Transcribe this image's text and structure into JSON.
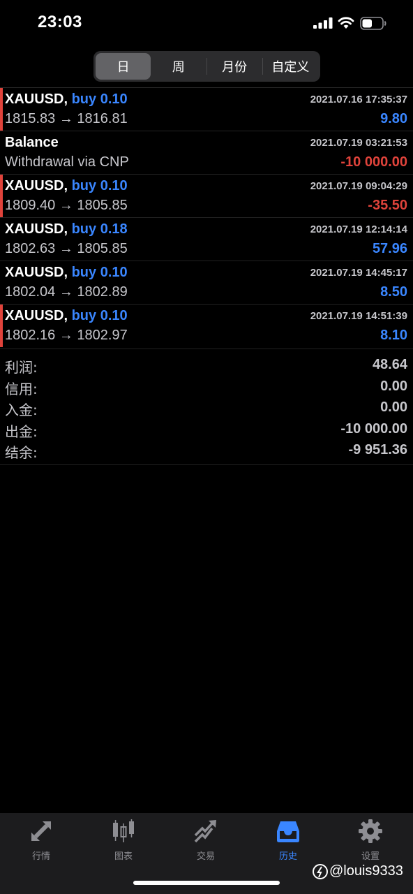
{
  "status": {
    "time": "23:03",
    "battery_level": 0.5
  },
  "segments": [
    {
      "label": "日",
      "active": true
    },
    {
      "label": "周",
      "active": false
    },
    {
      "label": "月份",
      "active": false
    },
    {
      "label": "自定义",
      "active": false
    }
  ],
  "deals": [
    {
      "symbol": "XAUUSD,",
      "direction": "buy 0.10",
      "prices": "1815.83 → 1816.81",
      "time": "2021.07.16 17:35:37",
      "profit": "9.80",
      "sign": "pos",
      "marker": true
    },
    {
      "symbol": "Balance",
      "direction": "",
      "prices": "Withdrawal via CNP",
      "time": "2021.07.19 03:21:53",
      "profit": "-10 000.00",
      "sign": "neg",
      "marker": false
    },
    {
      "symbol": "XAUUSD,",
      "direction": "buy 0.10",
      "prices": "1809.40 → 1805.85",
      "time": "2021.07.19 09:04:29",
      "profit": "-35.50",
      "sign": "neg",
      "marker": true
    },
    {
      "symbol": "XAUUSD,",
      "direction": "buy 0.18",
      "prices": "1802.63 → 1805.85",
      "time": "2021.07.19 12:14:14",
      "profit": "57.96",
      "sign": "pos",
      "marker": false
    },
    {
      "symbol": "XAUUSD,",
      "direction": "buy 0.10",
      "prices": "1802.04 → 1802.89",
      "time": "2021.07.19 14:45:17",
      "profit": "8.50",
      "sign": "pos",
      "marker": false
    },
    {
      "symbol": "XAUUSD,",
      "direction": "buy 0.10",
      "prices": "1802.16 → 1802.97",
      "time": "2021.07.19 14:51:39",
      "profit": "8.10",
      "sign": "pos",
      "marker": true
    }
  ],
  "summary": [
    {
      "label": "利润:",
      "value": "48.64"
    },
    {
      "label": "信用:",
      "value": "0.00"
    },
    {
      "label": "入金:",
      "value": "0.00"
    },
    {
      "label": "出金:",
      "value": "-10 000.00"
    },
    {
      "label": "结余:",
      "value": "-9 951.36"
    }
  ],
  "tabs": [
    {
      "label": "行情",
      "icon": "quotes-icon",
      "active": false
    },
    {
      "label": "图表",
      "icon": "chart-icon",
      "active": false
    },
    {
      "label": "交易",
      "icon": "trade-icon",
      "active": false
    },
    {
      "label": "历史",
      "icon": "history-icon",
      "active": true
    },
    {
      "label": "设置",
      "icon": "settings-icon",
      "active": false
    }
  ],
  "watermark": "@louis9333",
  "colors": {
    "accent": "#3a86ff",
    "loss": "#e0433b",
    "background": "#000000",
    "tabbar": "#1c1c1e"
  }
}
